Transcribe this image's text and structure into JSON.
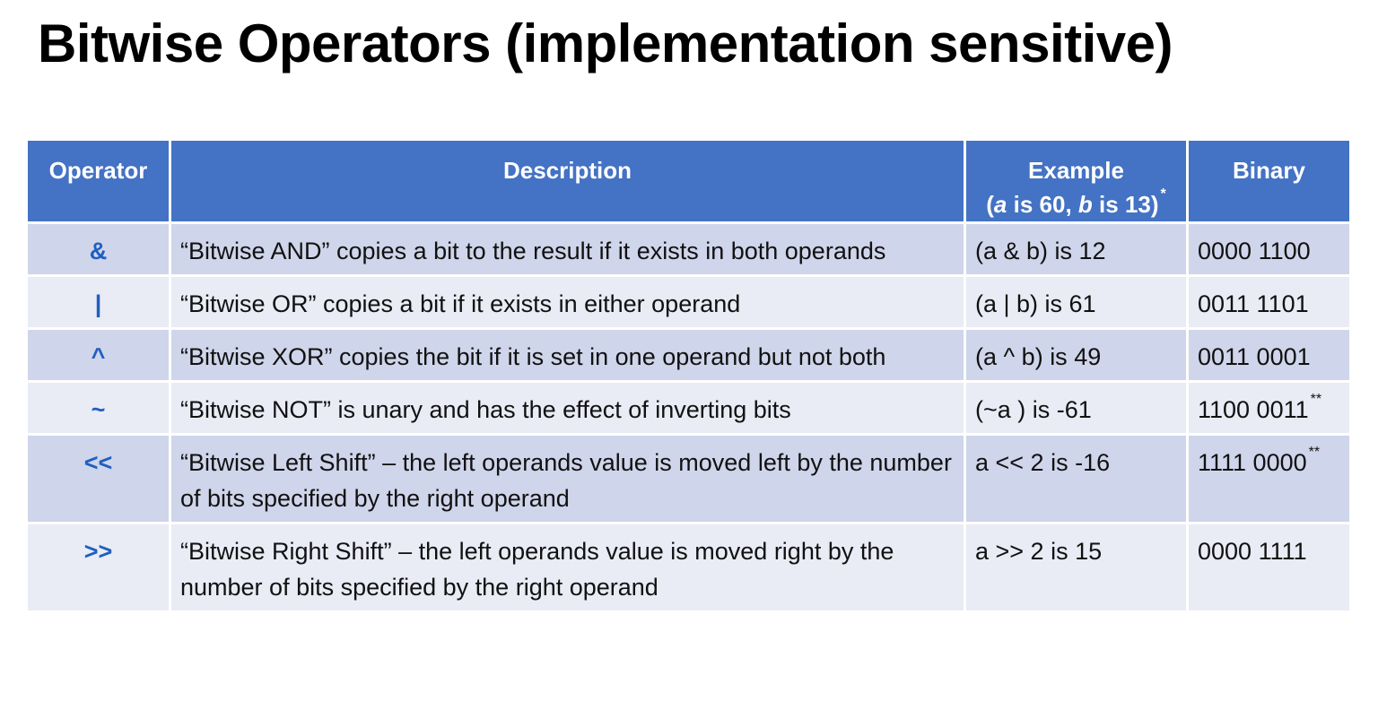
{
  "title": "Bitwise Operators (implementation sensitive)",
  "table": {
    "headers": {
      "operator": "Operator",
      "description": "Description",
      "example_line1": "Example",
      "example_open": "(",
      "example_var_a": "a",
      "example_mid": " is 60, ",
      "example_var_b": "b",
      "example_close": " is 13)",
      "example_marker": "*",
      "binary": "Binary"
    },
    "rows": [
      {
        "operator": "&",
        "description": "“Bitwise AND” copies a bit to the result if it exists in both operands",
        "example": "(a & b) is 12",
        "binary": "0000 1100",
        "marker": ""
      },
      {
        "operator": "|",
        "description": "“Bitwise OR” copies a bit if it exists in either operand",
        "example": "(a | b) is 61",
        "binary": "0011 1101",
        "marker": ""
      },
      {
        "operator": "^",
        "description": "“Bitwise XOR” copies the bit if it is set in one operand but not both",
        "example": "(a ^ b) is 49",
        "binary": "0011 0001",
        "marker": ""
      },
      {
        "operator": "~",
        "description": "“Bitwise NOT” is unary and has the effect of inverting bits",
        "example": "(~a ) is -61",
        "binary": "1100 0011",
        "marker": "**"
      },
      {
        "operator": "<<",
        "description": "“Bitwise Left Shift” – the left operands value is moved left by the number of bits specified by the right operand",
        "example": "a << 2 is -16",
        "binary": "1111 0000",
        "marker": "**"
      },
      {
        "operator": ">>",
        "description": "“Bitwise Right Shift” – the left operands value is moved right by the number of bits specified by the right operand",
        "example": "a >> 2 is 15",
        "binary": "0000 1111",
        "marker": ""
      }
    ]
  },
  "colors": {
    "header_bg": "#4472c4",
    "row_dark": "#cfd5ea",
    "row_light": "#e9ebf5",
    "operator_text": "#1f5fbf"
  }
}
